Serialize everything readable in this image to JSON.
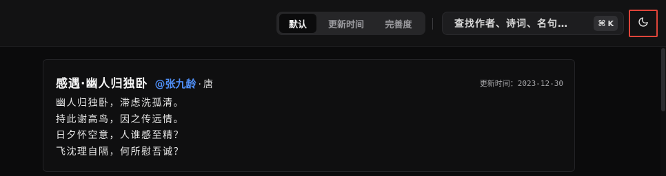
{
  "header": {
    "sort_tabs": [
      {
        "label": "默认",
        "active": true
      },
      {
        "label": "更新时间",
        "active": false
      },
      {
        "label": "完善度",
        "active": false
      }
    ],
    "search": {
      "placeholder": "查找作者、诗词、名句…",
      "shortcut_symbol": "⌘",
      "shortcut_key": "K"
    },
    "theme_toggle_icon": "moon-icon",
    "highlight_color": "#e0453a"
  },
  "poem": {
    "title": "感遇·幽人归独卧",
    "author": "@张九龄",
    "separator": "·",
    "dynasty": "唐",
    "updated_label": "更新时间：",
    "updated_date": "2023-12-30",
    "verses": [
      "幽人归独卧，滞虑洗孤清。",
      "持此谢高鸟，因之传远情。",
      "日夕怀空意，人谁感至精？",
      "飞沈理自隔，何所慰吾诚？"
    ],
    "author_color": "#4f8ff7"
  }
}
